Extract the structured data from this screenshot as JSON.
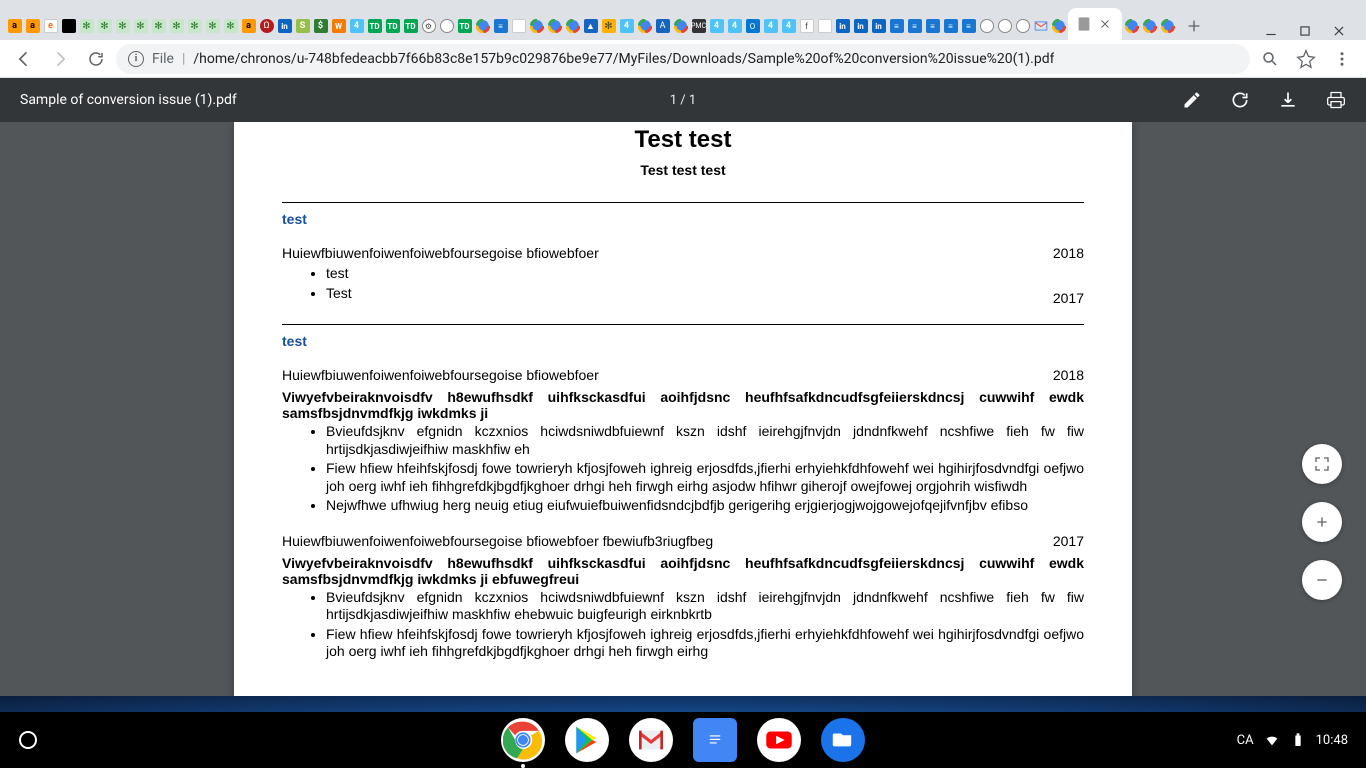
{
  "browser": {
    "active_tab_title": "",
    "url_scheme": "File",
    "url_path": "/home/chronos/u-748bfedeacbb7f66b83c8e157b9c029876be9e77/MyFiles/Downloads/Sample%20of%20conversion%20issue%20(1).pdf",
    "inactive_tabs_count": 64
  },
  "pdf_viewer": {
    "file_name": "Sample of conversion issue (1).pdf",
    "page_indicator": "1 / 1"
  },
  "document": {
    "title": "Test test",
    "subtitle": "Test test test",
    "sections": [
      {
        "heading": "test",
        "entries": [
          {
            "title": "Huiewfbiuwenfoiwenfoiwebfoursegoise bfiowebfoer",
            "year": "2018",
            "bullets": [
              "test",
              "Test"
            ]
          }
        ],
        "trailing_year": "2017"
      },
      {
        "heading": "test",
        "entries": [
          {
            "title": "Huiewfbiuwenfoiwenfoiwebfoursegoise bfiowebfoer",
            "year": "2018",
            "bold_line": "Viwyefvbeiraknvoisdfv h8ewufhsdkf uihfksckasdfui aoihfjdsnc heufhfsafkdncudfsgfeiierskdncsj cuwwihf ewdk samsfbsjdnvmdfkjg iwkdmks ji",
            "bullets": [
              "Bvieufdsjknv efgnidn kczxnios hciwdsniwdbfuiewnf kszn idshf ieirehgjfnvjdn jdndnfkwehf ncshfiwe fieh fw fiw hrtijsdkjasdiwjeifhiw maskhfiw eh",
              "Fiew hfiew hfeihfskjfosdj fowe towrieryh kfjosjfoweh ighreig erjosdfds,jfierhi erhyiehkfdhfowehf wei hgihirjfosdvndfgi oefjwo joh oerg iwhf ieh fihhgrefdkjbgdfjkghoer drhgi heh firwgh eirhg asjodw hfihwr giherojf owejfowej orgjohrih wisfiwdh",
              "Nejwfhwe ufhwiug herg neuig etiug eiufwuiefbuiwenfidsndcjbdfjb gerigerihg erjgierjogjwojgowejofqejifvnfjbv efibso"
            ]
          },
          {
            "title": "Huiewfbiuwenfoiwenfoiwebfoursegoise bfiowebfoer fbewiufb3riugfbeg",
            "year": "2017",
            "bold_line": "Viwyefvbeiraknvoisdfv h8ewufhsdkf uihfksckasdfui aoihfjdsnc heufhfsafkdncudfsgfeiierskdncsj cuwwihf ewdk samsfbsjdnvmdfkjg iwkdmks ji ebfuwegfreui",
            "bullets": [
              "Bvieufdsjknv efgnidn kczxnios hciwdsniwdbfuiewnf kszn idshf ieirehgjfnvjdn jdndnfkwehf ncshfiwe fieh fw fiw hrtijsdkjasdiwjeifhiw maskhfiw ehebwuic buigfeurigh eirknbkrtb",
              "Fiew hfiew hfeihfskjfosdj fowe towrieryh kfjosjfoweh ighreig erjosdfds,jfierhi erhyiehkfdhfowehf wei hgihirjfosdvndfgi oefjwo joh oerg iwhf ieh fihhgrefdkjbgdfjkghoer drhgi heh firwgh eirhg"
            ]
          }
        ]
      }
    ]
  },
  "shelf": {
    "locale": "CA",
    "time": "10:48"
  }
}
